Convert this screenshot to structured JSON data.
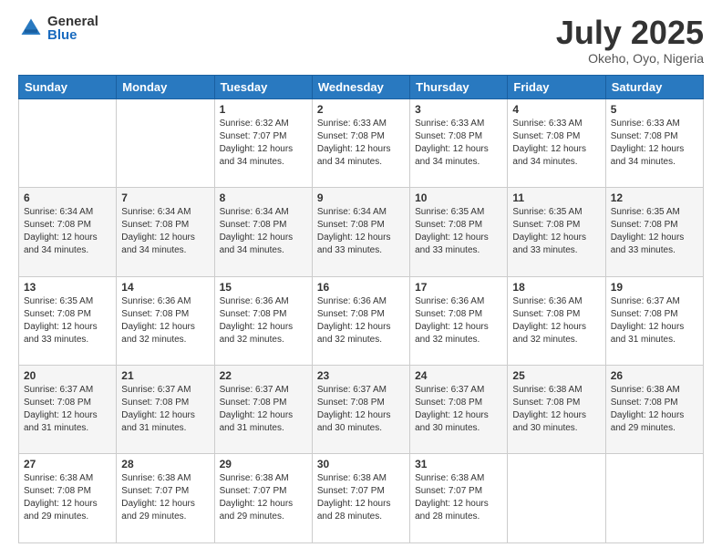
{
  "logo": {
    "general": "General",
    "blue": "Blue"
  },
  "header": {
    "month_year": "July 2025",
    "location": "Okeho, Oyo, Nigeria"
  },
  "days_of_week": [
    "Sunday",
    "Monday",
    "Tuesday",
    "Wednesday",
    "Thursday",
    "Friday",
    "Saturday"
  ],
  "weeks": [
    [
      {
        "day": "",
        "info": ""
      },
      {
        "day": "",
        "info": ""
      },
      {
        "day": "1",
        "info": "Sunrise: 6:32 AM\nSunset: 7:07 PM\nDaylight: 12 hours and 34 minutes."
      },
      {
        "day": "2",
        "info": "Sunrise: 6:33 AM\nSunset: 7:08 PM\nDaylight: 12 hours and 34 minutes."
      },
      {
        "day": "3",
        "info": "Sunrise: 6:33 AM\nSunset: 7:08 PM\nDaylight: 12 hours and 34 minutes."
      },
      {
        "day": "4",
        "info": "Sunrise: 6:33 AM\nSunset: 7:08 PM\nDaylight: 12 hours and 34 minutes."
      },
      {
        "day": "5",
        "info": "Sunrise: 6:33 AM\nSunset: 7:08 PM\nDaylight: 12 hours and 34 minutes."
      }
    ],
    [
      {
        "day": "6",
        "info": "Sunrise: 6:34 AM\nSunset: 7:08 PM\nDaylight: 12 hours and 34 minutes."
      },
      {
        "day": "7",
        "info": "Sunrise: 6:34 AM\nSunset: 7:08 PM\nDaylight: 12 hours and 34 minutes."
      },
      {
        "day": "8",
        "info": "Sunrise: 6:34 AM\nSunset: 7:08 PM\nDaylight: 12 hours and 34 minutes."
      },
      {
        "day": "9",
        "info": "Sunrise: 6:34 AM\nSunset: 7:08 PM\nDaylight: 12 hours and 33 minutes."
      },
      {
        "day": "10",
        "info": "Sunrise: 6:35 AM\nSunset: 7:08 PM\nDaylight: 12 hours and 33 minutes."
      },
      {
        "day": "11",
        "info": "Sunrise: 6:35 AM\nSunset: 7:08 PM\nDaylight: 12 hours and 33 minutes."
      },
      {
        "day": "12",
        "info": "Sunrise: 6:35 AM\nSunset: 7:08 PM\nDaylight: 12 hours and 33 minutes."
      }
    ],
    [
      {
        "day": "13",
        "info": "Sunrise: 6:35 AM\nSunset: 7:08 PM\nDaylight: 12 hours and 33 minutes."
      },
      {
        "day": "14",
        "info": "Sunrise: 6:36 AM\nSunset: 7:08 PM\nDaylight: 12 hours and 32 minutes."
      },
      {
        "day": "15",
        "info": "Sunrise: 6:36 AM\nSunset: 7:08 PM\nDaylight: 12 hours and 32 minutes."
      },
      {
        "day": "16",
        "info": "Sunrise: 6:36 AM\nSunset: 7:08 PM\nDaylight: 12 hours and 32 minutes."
      },
      {
        "day": "17",
        "info": "Sunrise: 6:36 AM\nSunset: 7:08 PM\nDaylight: 12 hours and 32 minutes."
      },
      {
        "day": "18",
        "info": "Sunrise: 6:36 AM\nSunset: 7:08 PM\nDaylight: 12 hours and 32 minutes."
      },
      {
        "day": "19",
        "info": "Sunrise: 6:37 AM\nSunset: 7:08 PM\nDaylight: 12 hours and 31 minutes."
      }
    ],
    [
      {
        "day": "20",
        "info": "Sunrise: 6:37 AM\nSunset: 7:08 PM\nDaylight: 12 hours and 31 minutes."
      },
      {
        "day": "21",
        "info": "Sunrise: 6:37 AM\nSunset: 7:08 PM\nDaylight: 12 hours and 31 minutes."
      },
      {
        "day": "22",
        "info": "Sunrise: 6:37 AM\nSunset: 7:08 PM\nDaylight: 12 hours and 31 minutes."
      },
      {
        "day": "23",
        "info": "Sunrise: 6:37 AM\nSunset: 7:08 PM\nDaylight: 12 hours and 30 minutes."
      },
      {
        "day": "24",
        "info": "Sunrise: 6:37 AM\nSunset: 7:08 PM\nDaylight: 12 hours and 30 minutes."
      },
      {
        "day": "25",
        "info": "Sunrise: 6:38 AM\nSunset: 7:08 PM\nDaylight: 12 hours and 30 minutes."
      },
      {
        "day": "26",
        "info": "Sunrise: 6:38 AM\nSunset: 7:08 PM\nDaylight: 12 hours and 29 minutes."
      }
    ],
    [
      {
        "day": "27",
        "info": "Sunrise: 6:38 AM\nSunset: 7:08 PM\nDaylight: 12 hours and 29 minutes."
      },
      {
        "day": "28",
        "info": "Sunrise: 6:38 AM\nSunset: 7:07 PM\nDaylight: 12 hours and 29 minutes."
      },
      {
        "day": "29",
        "info": "Sunrise: 6:38 AM\nSunset: 7:07 PM\nDaylight: 12 hours and 29 minutes."
      },
      {
        "day": "30",
        "info": "Sunrise: 6:38 AM\nSunset: 7:07 PM\nDaylight: 12 hours and 28 minutes."
      },
      {
        "day": "31",
        "info": "Sunrise: 6:38 AM\nSunset: 7:07 PM\nDaylight: 12 hours and 28 minutes."
      },
      {
        "day": "",
        "info": ""
      },
      {
        "day": "",
        "info": ""
      }
    ]
  ]
}
